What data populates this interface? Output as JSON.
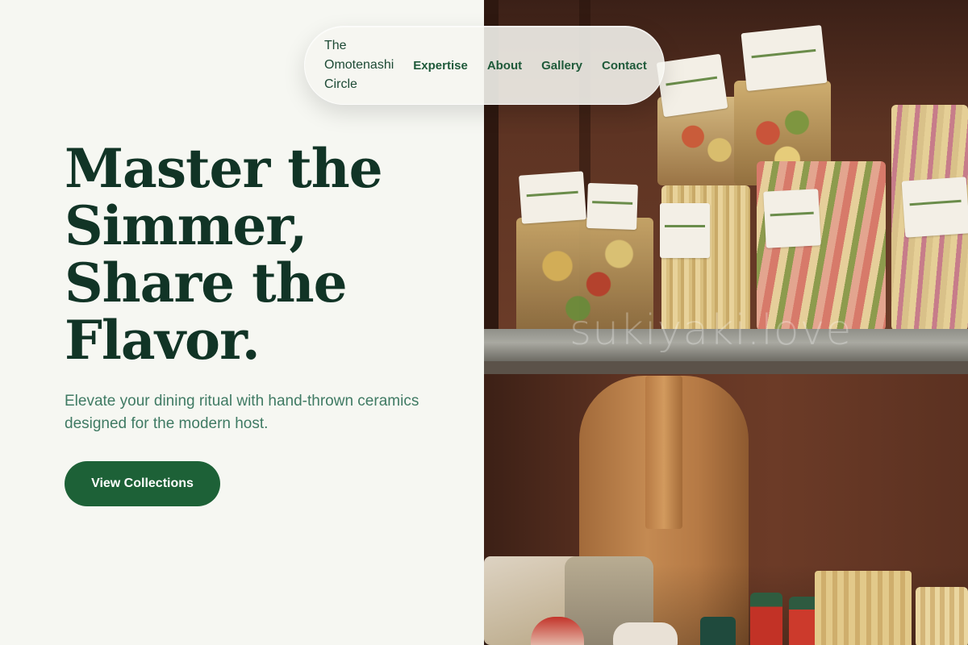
{
  "nav": {
    "brand": "The Omotenashi Circle",
    "links": [
      "Expertise",
      "About",
      "Gallery",
      "Contact"
    ]
  },
  "hero": {
    "title": "Master the Simmer, Share the Flavor.",
    "subtitle": "Elevate your dining ritual with hand-thrown ceramics designed for the modern host.",
    "cta_label": "View Collections"
  },
  "image": {
    "watermark": "sukiyaki.love"
  },
  "colors": {
    "background": "#f6f7f2",
    "heading": "#113426",
    "subtitle": "#3f7a63",
    "nav_text": "#1f5a3a",
    "cta_background": "#1d6137",
    "cta_text": "#ffffff"
  }
}
